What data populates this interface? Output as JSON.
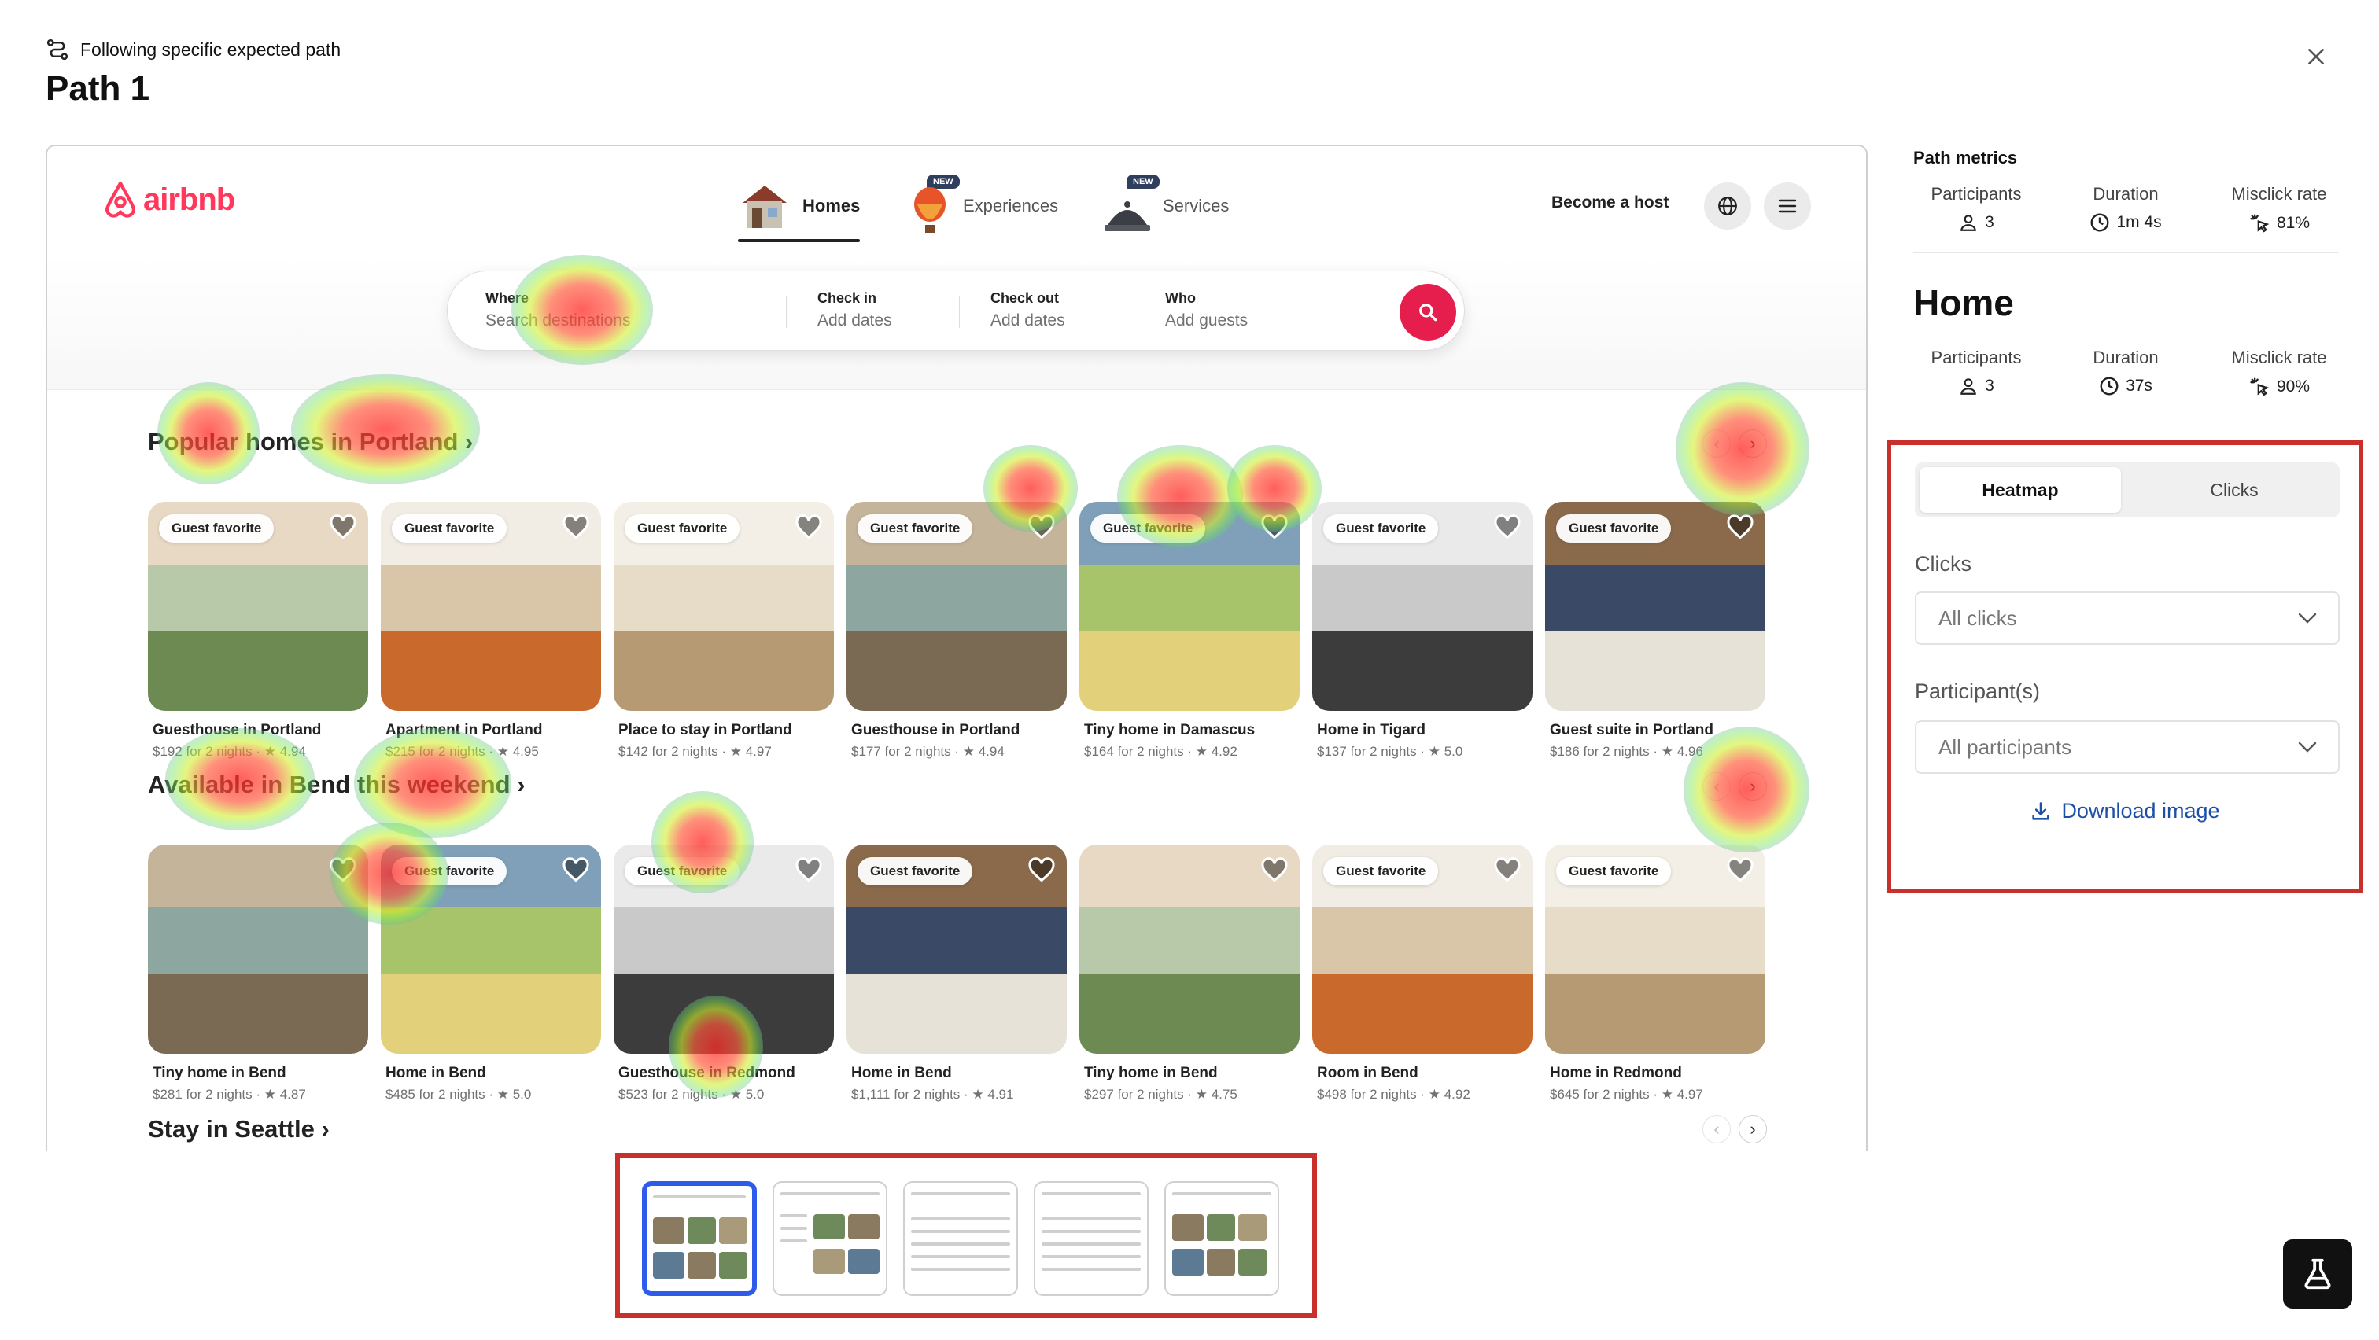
{
  "header": {
    "subtitle": "Following specific expected path",
    "title": "Path 1"
  },
  "airbnb": {
    "logo": "airbnb",
    "nav": [
      {
        "label": "Homes",
        "badge": ""
      },
      {
        "label": "Experiences",
        "badge": "NEW"
      },
      {
        "label": "Services",
        "badge": "NEW"
      }
    ],
    "become_host": "Become a host",
    "search": {
      "where_label": "Where",
      "where_value": "Search destinations",
      "checkin_label": "Check in",
      "checkin_value": "Add dates",
      "checkout_label": "Check out",
      "checkout_value": "Add dates",
      "who_label": "Who",
      "who_value": "Add guests"
    },
    "sections": [
      {
        "title": "Popular homes in Portland ›",
        "cards": [
          {
            "badge": "Guest favorite",
            "title": "Guesthouse in Portland",
            "meta": "$192 for 2 nights · ★ 4.94"
          },
          {
            "badge": "Guest favorite",
            "title": "Apartment in Portland",
            "meta": "$215 for 2 nights · ★ 4.95"
          },
          {
            "badge": "Guest favorite",
            "title": "Place to stay in Portland",
            "meta": "$142 for 2 nights · ★ 4.97"
          },
          {
            "badge": "Guest favorite",
            "title": "Guesthouse in Portland",
            "meta": "$177 for 2 nights · ★ 4.94"
          },
          {
            "badge": "Guest favorite",
            "title": "Tiny home in Damascus",
            "meta": "$164 for 2 nights · ★ 4.92"
          },
          {
            "badge": "Guest favorite",
            "title": "Home in Tigard",
            "meta": "$137 for 2 nights · ★ 5.0"
          },
          {
            "badge": "Guest favorite",
            "title": "Guest suite in Portland",
            "meta": "$186 for 2 nights · ★ 4.96"
          }
        ]
      },
      {
        "title": "Available in Bend this weekend ›",
        "cards": [
          {
            "badge": "",
            "title": "Tiny home in Bend",
            "meta": "$281 for 2 nights · ★ 4.87"
          },
          {
            "badge": "Guest favorite",
            "title": "Home in Bend",
            "meta": "$485 for 2 nights · ★ 5.0"
          },
          {
            "badge": "Guest favorite",
            "title": "Guesthouse in Redmond",
            "meta": "$523 for 2 nights · ★ 5.0"
          },
          {
            "badge": "Guest favorite",
            "title": "Home in Bend",
            "meta": "$1,111 for 2 nights · ★ 4.91"
          },
          {
            "badge": "",
            "title": "Tiny home in Bend",
            "meta": "$297 for 2 nights · ★ 4.75"
          },
          {
            "badge": "Guest favorite",
            "title": "Room in Bend",
            "meta": "$498 for 2 nights · ★ 4.92"
          },
          {
            "badge": "Guest favorite",
            "title": "Home in Redmond",
            "meta": "$645 for 2 nights · ★ 4.97"
          }
        ]
      },
      {
        "title": "Stay in Seattle ›",
        "cards": []
      }
    ]
  },
  "path_metrics": {
    "title": "Path metrics",
    "participants_label": "Participants",
    "participants": "3",
    "duration_label": "Duration",
    "duration": "1m 4s",
    "misclick_label": "Misclick rate",
    "misclick": "81%"
  },
  "screen": {
    "title": "Home",
    "participants_label": "Participants",
    "participants": "3",
    "duration_label": "Duration",
    "duration": "37s",
    "misclick_label": "Misclick rate",
    "misclick": "90%"
  },
  "controls": {
    "tabs": [
      "Heatmap",
      "Clicks"
    ],
    "active_tab": "Heatmap",
    "clicks_label": "Clicks",
    "clicks_value": "All clicks",
    "participants_label": "Participant(s)",
    "participants_value": "All participants",
    "download": "Download image"
  },
  "thumbnails": {
    "count": 5,
    "selected": 1
  },
  "colors": {
    "brand": "#ff385c",
    "highlight_box": "#c9302c",
    "selected_thumb": "#2f5bea",
    "link": "#1e4fa8"
  }
}
